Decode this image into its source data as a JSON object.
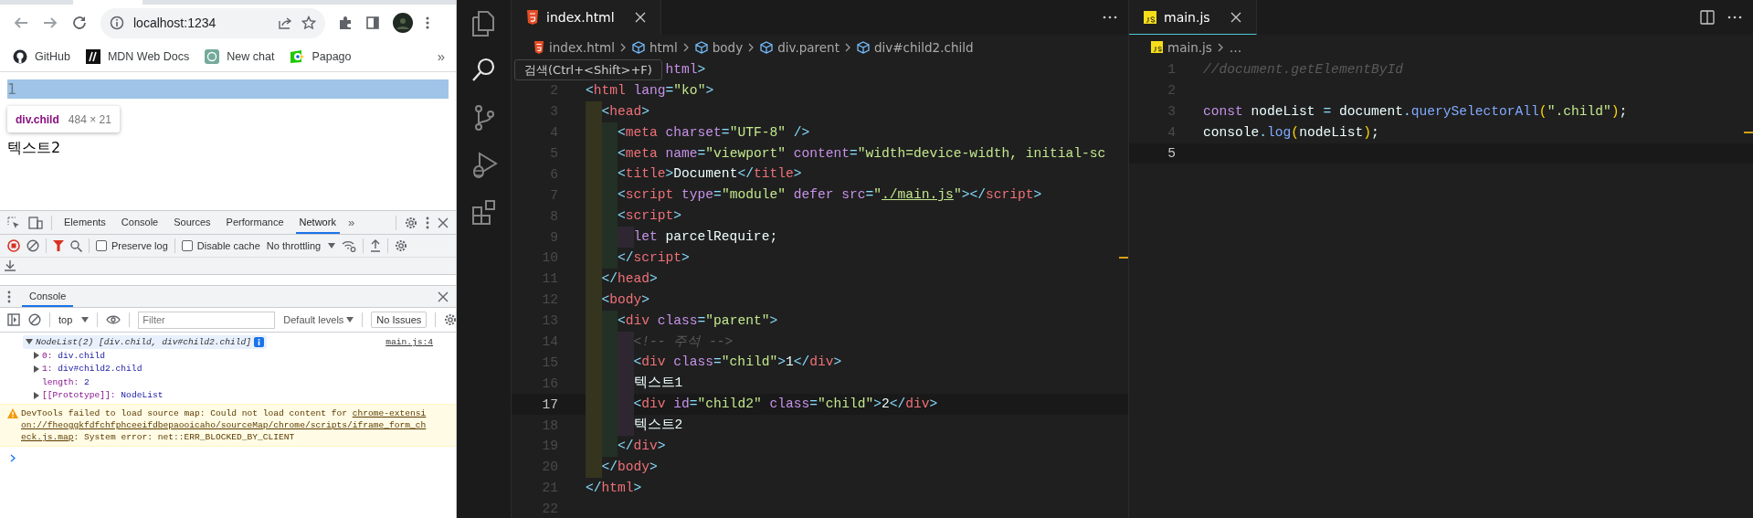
{
  "browser": {
    "url": "localhost:1234",
    "bookmarks": [
      {
        "label": "GitHub",
        "kind": "github"
      },
      {
        "label": "MDN Web Docs",
        "kind": "mdn"
      },
      {
        "label": "New chat",
        "kind": "chat"
      },
      {
        "label": "Papago",
        "kind": "papago"
      }
    ],
    "more_bookmarks": "»",
    "page": {
      "lines": [
        {
          "text": "1",
          "highlighted": true
        },
        {
          "text": "텍스트2",
          "highlighted": false
        }
      ],
      "inspect_tooltip": {
        "selector": "div.child",
        "size": "484 × 21"
      }
    },
    "devtools": {
      "tabs": [
        {
          "label": "Elements",
          "selected": false
        },
        {
          "label": "Console",
          "selected": false
        },
        {
          "label": "Sources",
          "selected": false
        },
        {
          "label": "Performance",
          "selected": false
        },
        {
          "label": "Network",
          "selected": true
        }
      ],
      "more_tabs": "»",
      "network_toolbar": {
        "options": [
          {
            "label": "Preserve log",
            "checked": false
          },
          {
            "label": "Disable cache",
            "checked": false
          }
        ],
        "throttling": "No throttling"
      },
      "drawer": {
        "tabs": [
          {
            "label": "Console",
            "selected": true
          }
        ],
        "context": "top",
        "filter_placeholder": "Filter",
        "levels": "Default levels",
        "issues": "No Issues",
        "log": {
          "summary": "NodeList(2) [div.child, div#child2.child]",
          "source": "main.js:4",
          "expanded": true,
          "properties": [
            {
              "key": "0:",
              "value": "div.child",
              "expandable": true
            },
            {
              "key": "1:",
              "value": "div#child2.child",
              "expandable": true
            },
            {
              "key": "length:",
              "value": "2",
              "expandable": false
            },
            {
              "key": "[[Prototype]]:",
              "value": "NodeList",
              "expandable": true
            }
          ]
        },
        "warning": {
          "lines": [
            [
              {
                "text": "DevTools failed to load source map: Could not load content for ",
                "link": false
              },
              {
                "text": "chrome-extensi",
                "link": true
              }
            ],
            [
              {
                "text": "on://fheoggkfdfchfphceeifdbepaooicaho/sourceMap/chrome/scripts/iframe_form_ch",
                "link": true
              }
            ],
            [
              {
                "text": "eck.js.map",
                "link": true
              },
              {
                "text": ": System error: net::ERR_BLOCKED_BY_CLIENT",
                "link": false
              }
            ]
          ]
        }
      }
    }
  },
  "vscode": {
    "activity_bar": [
      {
        "kind": "explorer",
        "selected": false
      },
      {
        "kind": "search",
        "selected": true
      },
      {
        "kind": "source-control",
        "selected": false
      },
      {
        "kind": "run-debug",
        "selected": false
      },
      {
        "kind": "extensions",
        "selected": false
      }
    ],
    "tooltip": "검색(Ctrl+<Shift>+F)",
    "editors": [
      {
        "focused": false,
        "tabs": [
          {
            "label": "index.html",
            "kind": "html",
            "selected": true
          }
        ],
        "breadcrumb": [
          {
            "label": "index.html",
            "kind": "html"
          },
          {
            "label": "html",
            "kind": "element"
          },
          {
            "label": "body",
            "kind": "element"
          },
          {
            "label": "div.parent",
            "kind": "element"
          },
          {
            "label": "div#child2.child",
            "kind": "element"
          }
        ],
        "lines": [
          {
            "covered": true,
            "current": false,
            "tokens": [
              {
                "kind": "keyword",
                "text": "html"
              },
              {
                "kind": "punct",
                "text": ">"
              }
            ]
          },
          {
            "number": "2",
            "current": false,
            "tokens": [
              {
                "kind": "punct",
                "text": "<"
              },
              {
                "kind": "tag",
                "text": "html"
              },
              {
                "kind": "attr",
                "text": " lang"
              },
              {
                "kind": "punct",
                "text": "="
              },
              {
                "kind": "str",
                "text": "\"ko\""
              },
              {
                "kind": "punct",
                "text": ">"
              }
            ]
          },
          {
            "number": "3",
            "current": false,
            "tokens": [
              {
                "kind": "punct",
                "text": "  <"
              },
              {
                "kind": "tag",
                "text": "head"
              },
              {
                "kind": "punct",
                "text": ">"
              }
            ]
          },
          {
            "number": "4",
            "current": false,
            "tokens": [
              {
                "kind": "punct",
                "text": "    <"
              },
              {
                "kind": "tag",
                "text": "meta"
              },
              {
                "kind": "attr",
                "text": " charset"
              },
              {
                "kind": "punct",
                "text": "="
              },
              {
                "kind": "str",
                "text": "\"UTF-8\""
              },
              {
                "kind": "punct",
                "text": " />"
              }
            ]
          },
          {
            "number": "5",
            "current": false,
            "tokens": [
              {
                "kind": "punct",
                "text": "    <"
              },
              {
                "kind": "tag",
                "text": "meta"
              },
              {
                "kind": "attr",
                "text": " name"
              },
              {
                "kind": "punct",
                "text": "="
              },
              {
                "kind": "str",
                "text": "\"viewport\""
              },
              {
                "kind": "attr",
                "text": " content"
              },
              {
                "kind": "punct",
                "text": "="
              },
              {
                "kind": "str",
                "text": "\"width=device-width, initial-sc"
              }
            ]
          },
          {
            "number": "6",
            "current": false,
            "tokens": [
              {
                "kind": "punct",
                "text": "    <"
              },
              {
                "kind": "tag",
                "text": "title"
              },
              {
                "kind": "punct",
                "text": ">"
              },
              {
                "kind": "text",
                "text": "Document"
              },
              {
                "kind": "punct",
                "text": "</"
              },
              {
                "kind": "tag",
                "text": "title"
              },
              {
                "kind": "punct",
                "text": ">"
              }
            ]
          },
          {
            "number": "7",
            "current": false,
            "tokens": [
              {
                "kind": "punct",
                "text": "    <"
              },
              {
                "kind": "tag",
                "text": "script"
              },
              {
                "kind": "attr",
                "text": " type"
              },
              {
                "kind": "punct",
                "text": "="
              },
              {
                "kind": "str",
                "text": "\"module\""
              },
              {
                "kind": "attr",
                "text": " defer src"
              },
              {
                "kind": "punct",
                "text": "="
              },
              {
                "kind": "str",
                "text": "\""
              },
              {
                "kind": "link",
                "text": "./main.js"
              },
              {
                "kind": "str",
                "text": "\""
              },
              {
                "kind": "punct",
                "text": "></"
              },
              {
                "kind": "tag",
                "text": "script"
              },
              {
                "kind": "punct",
                "text": ">"
              }
            ]
          },
          {
            "number": "8",
            "current": false,
            "tokens": [
              {
                "kind": "punct",
                "text": "    <"
              },
              {
                "kind": "tag",
                "text": "script"
              },
              {
                "kind": "punct",
                "text": ">"
              }
            ]
          },
          {
            "number": "9",
            "current": false,
            "tokens": [
              {
                "kind": "keyword",
                "text": "      let"
              },
              {
                "kind": "text",
                "text": " parcelRequire;"
              }
            ]
          },
          {
            "number": "10",
            "current": false,
            "ruler_mark": true,
            "tokens": [
              {
                "kind": "punct",
                "text": "    </"
              },
              {
                "kind": "tag",
                "text": "script"
              },
              {
                "kind": "punct",
                "text": ">"
              }
            ]
          },
          {
            "number": "11",
            "current": false,
            "tokens": [
              {
                "kind": "punct",
                "text": "  </"
              },
              {
                "kind": "tag",
                "text": "head"
              },
              {
                "kind": "punct",
                "text": ">"
              }
            ]
          },
          {
            "number": "12",
            "current": false,
            "tokens": [
              {
                "kind": "punct",
                "text": "  <"
              },
              {
                "kind": "tag",
                "text": "body"
              },
              {
                "kind": "punct",
                "text": ">"
              }
            ]
          },
          {
            "number": "13",
            "current": false,
            "tokens": [
              {
                "kind": "punct",
                "text": "    <"
              },
              {
                "kind": "tag",
                "text": "div"
              },
              {
                "kind": "attr",
                "text": " class"
              },
              {
                "kind": "punct",
                "text": "="
              },
              {
                "kind": "str",
                "text": "\"parent\""
              },
              {
                "kind": "punct",
                "text": ">"
              }
            ]
          },
          {
            "number": "14",
            "current": false,
            "tokens": [
              {
                "kind": "comment",
                "text": "      <!-- 주석 -->"
              }
            ]
          },
          {
            "number": "15",
            "current": false,
            "tokens": [
              {
                "kind": "punct",
                "text": "      <"
              },
              {
                "kind": "tag",
                "text": "div"
              },
              {
                "kind": "attr",
                "text": " class"
              },
              {
                "kind": "punct",
                "text": "="
              },
              {
                "kind": "str",
                "text": "\"child\""
              },
              {
                "kind": "punct",
                "text": ">"
              },
              {
                "kind": "text",
                "text": "1"
              },
              {
                "kind": "punct",
                "text": "</"
              },
              {
                "kind": "tag",
                "text": "div"
              },
              {
                "kind": "punct",
                "text": ">"
              }
            ]
          },
          {
            "number": "16",
            "current": false,
            "tokens": [
              {
                "kind": "text",
                "text": "      텍스트1"
              }
            ]
          },
          {
            "number": "17",
            "current": true,
            "tokens": [
              {
                "kind": "punct",
                "text": "      <"
              },
              {
                "kind": "tag",
                "text": "div"
              },
              {
                "kind": "attr",
                "text": " id"
              },
              {
                "kind": "punct",
                "text": "="
              },
              {
                "kind": "str",
                "text": "\"child2\""
              },
              {
                "kind": "attr",
                "text": " class"
              },
              {
                "kind": "punct",
                "text": "="
              },
              {
                "kind": "str",
                "text": "\"child\""
              },
              {
                "kind": "punct",
                "text": ">"
              },
              {
                "kind": "text",
                "text": "2"
              },
              {
                "kind": "punct",
                "text": "</"
              },
              {
                "kind": "tag",
                "text": "div"
              },
              {
                "kind": "punct",
                "text": ">"
              }
            ]
          },
          {
            "number": "18",
            "current": false,
            "tokens": [
              {
                "kind": "text",
                "text": "      텍스트2"
              }
            ]
          },
          {
            "number": "19",
            "current": false,
            "tokens": [
              {
                "kind": "punct",
                "text": "    </"
              },
              {
                "kind": "tag",
                "text": "div"
              },
              {
                "kind": "punct",
                "text": ">"
              }
            ]
          },
          {
            "number": "20",
            "current": false,
            "tokens": [
              {
                "kind": "punct",
                "text": "  </"
              },
              {
                "kind": "tag",
                "text": "body"
              },
              {
                "kind": "punct",
                "text": ">"
              }
            ]
          },
          {
            "number": "21",
            "current": false,
            "tokens": [
              {
                "kind": "punct",
                "text": "</"
              },
              {
                "kind": "tag",
                "text": "html"
              },
              {
                "kind": "punct",
                "text": ">"
              }
            ]
          },
          {
            "number": "22",
            "current": false
          }
        ]
      },
      {
        "focused": true,
        "tabs": [
          {
            "label": "main.js",
            "kind": "js",
            "selected": true
          }
        ],
        "breadcrumb": [
          {
            "label": "main.js",
            "kind": "js"
          },
          {
            "label": "…",
            "kind": "more"
          }
        ],
        "lines": [
          {
            "number": "1",
            "current": false,
            "tokens": [
              {
                "kind": "comment",
                "text": "//document.getElementById"
              }
            ]
          },
          {
            "number": "2",
            "current": false
          },
          {
            "number": "3",
            "current": false,
            "tokens": [
              {
                "kind": "keyword",
                "text": "const"
              },
              {
                "kind": "text",
                "text": " nodeList "
              },
              {
                "kind": "punct",
                "text": "="
              },
              {
                "kind": "text",
                "text": " document"
              },
              {
                "kind": "punct",
                "text": "."
              },
              {
                "kind": "fn",
                "text": "querySelectorAll"
              },
              {
                "kind": "paren",
                "text": "("
              },
              {
                "kind": "str",
                "text": "\".child\""
              },
              {
                "kind": "paren",
                "text": ")"
              },
              {
                "kind": "text",
                "text": ";"
              }
            ]
          },
          {
            "number": "4",
            "current": false,
            "ruler_mark": true,
            "tokens": [
              {
                "kind": "text",
                "text": "console"
              },
              {
                "kind": "punct",
                "text": "."
              },
              {
                "kind": "fn",
                "text": "log"
              },
              {
                "kind": "paren",
                "text": "("
              },
              {
                "kind": "text",
                "text": "nodeList"
              },
              {
                "kind": "paren",
                "text": ")"
              },
              {
                "kind": "text",
                "text": ";"
              }
            ]
          },
          {
            "number": "5",
            "current": true
          }
        ]
      }
    ]
  }
}
